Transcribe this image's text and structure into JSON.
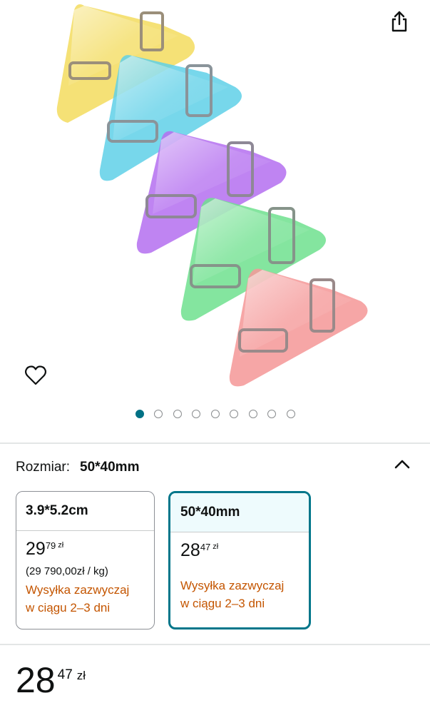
{
  "gallery": {
    "image_count": 9,
    "active_index": 0
  },
  "icons": {
    "share": "share-icon",
    "wishlist": "heart-outline-icon",
    "collapse": "chevron-up-icon"
  },
  "variation": {
    "label": "Rozmiar:",
    "selected_value": "50*40mm"
  },
  "options": [
    {
      "name": "3.9*5.2cm",
      "price_whole": "29",
      "price_fraction": "79",
      "currency": "zł",
      "unit_price": "(29 790,00zł / kg)",
      "shipping_line1": "Wysyłka zazwyczaj",
      "shipping_line2": "w ciągu 2–3 dni"
    },
    {
      "name": "50*40mm",
      "price_whole": "28",
      "price_fraction": "47",
      "currency": "zł",
      "shipping_line1": "Wysyłka zazwyczaj",
      "shipping_line2": "w ciągu 2–3 dni"
    }
  ],
  "price": {
    "whole": "28",
    "fraction": "47",
    "currency": "zł"
  },
  "colors": {
    "accent_teal": "#007185",
    "selected_border": "#00768a",
    "shipping_orange": "#c45500",
    "clip_yellow": "#f3dc5e",
    "clip_cyan": "#5fd0e8",
    "clip_purple": "#b46ef0",
    "clip_green": "#6fe08e",
    "clip_pink": "#f59a9a"
  }
}
